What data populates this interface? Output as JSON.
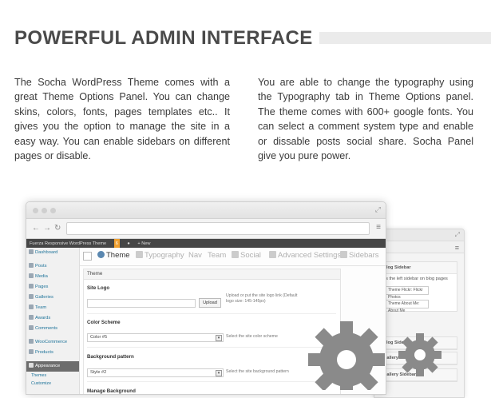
{
  "heading": "POWERFUL ADMIN INTERFACE",
  "paragraphs": {
    "left": "The Socha WordPress Theme comes with a great Theme Options Panel. You can change skins, colors, fonts, pages templates etc.. It gives you the option to manage the site in a easy way. You can enable sidebars on different pages or disable.",
    "right": "You are able to change the typography using the Typography tab in Theme Options panel. The theme comes with 600+ google fonts. You can select a comment system type and enable or dissable posts social share. Socha Panel give you pure power."
  },
  "adminbar": {
    "site_name": "Fuerza Responsive WordPress Theme",
    "updates": "6",
    "new": "+ New"
  },
  "sidebar": {
    "items": [
      "Dashboard",
      "Posts",
      "Media",
      "Pages",
      "Galleries",
      "Team",
      "Awards",
      "Comments",
      "WooCommerce",
      "Products",
      "Appearance"
    ],
    "sub_items": [
      "Themes",
      "Customize"
    ]
  },
  "tabs": [
    "Theme",
    "Typography",
    "Nav",
    "Team",
    "Social",
    "Advanced Settings",
    "Sidebars"
  ],
  "panel": {
    "header": "Theme",
    "site_logo_label": "Site Logo",
    "upload_button": "Upload",
    "site_logo_hint": "Upload or put the site logo link (Default logo size: 145-145px)",
    "color_scheme_label": "Color Scheme",
    "color_scheme_value": "Color #5",
    "color_scheme_hint": "Select the site color scheme",
    "background_pattern_label": "Background pattern",
    "background_pattern_value": "Style #2",
    "background_pattern_hint": "Select the site background pattern",
    "manage_background_label": "Manage Background"
  },
  "back_panel": {
    "title": "Blog Sidebar",
    "desc": "as the left sidebar on blog pages",
    "row1_label": "Theme Flickr: Flickr Photos",
    "row1_value": "Flickr Photos",
    "row2_label": "Theme About Me: About Me",
    "row2_value": "About Me",
    "title2": "Blog Sidebar",
    "title3": "Gallery Sidebar",
    "title4": "Gallery Sidebar"
  },
  "colors": {
    "heading": "#4a4a4a",
    "adminbar": "#464646",
    "link": "#21759b",
    "gear": "#8a8a8a"
  }
}
